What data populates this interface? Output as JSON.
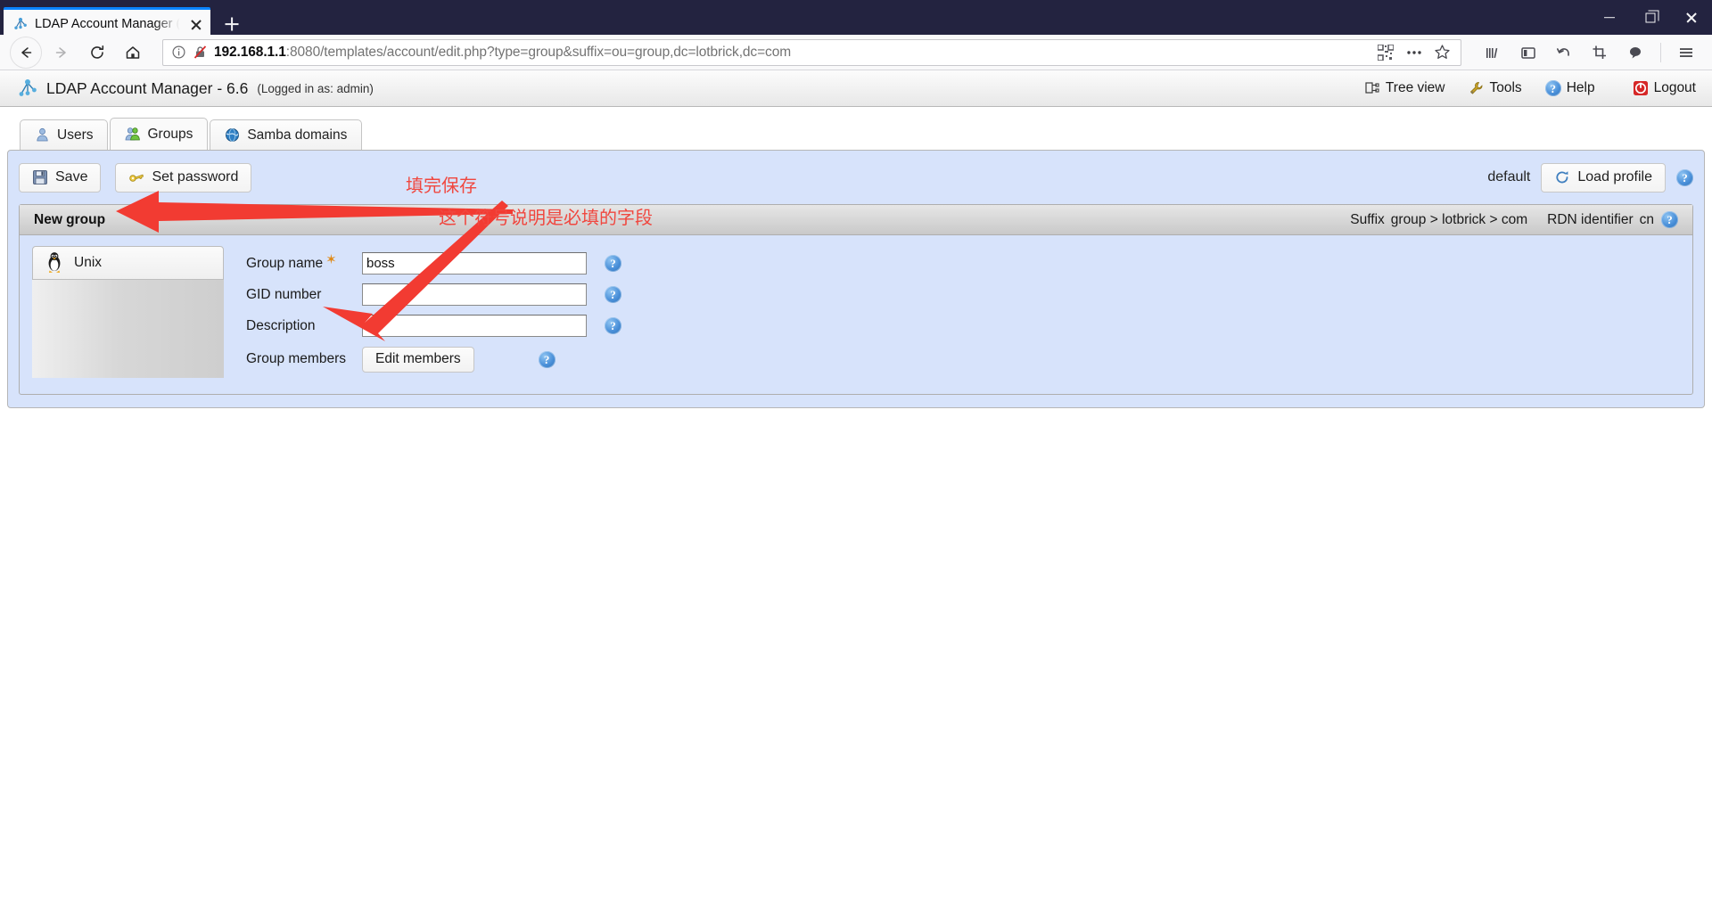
{
  "browser": {
    "tab": {
      "title": "LDAP Account Manager (ope",
      "favicon": "ldap-tree-icon",
      "close": "close-icon"
    },
    "new_tab_label": "+",
    "window_controls": {
      "minimize": "minimize-icon",
      "maximize": "restore-icon",
      "close": "close-icon"
    },
    "nav": {
      "back": "back-arrow-icon",
      "forward": "forward-arrow-icon",
      "reload": "reload-icon",
      "home": "home-icon"
    },
    "url": {
      "host": "192.168.1.1",
      "rest": ":8080/templates/account/edit.php?type=group&suffix=ou=group,dc=lotbrick,dc=com",
      "full": "192.168.1.1:8080/templates/account/edit.php?type=group&suffix=ou=group,dc=lotbrick,dc=com",
      "info_icon": "page-info-icon",
      "insecure_icon": "broken-lock-icon",
      "qr_icon": "qr-code-icon",
      "more_icon": "ellipsis-icon",
      "bookmark_icon": "star-icon"
    },
    "toolbar_right": [
      "library-icon",
      "sidebar-icon",
      "undo-icon",
      "screenshot-icon",
      "pocket-icon",
      "menu-icon"
    ]
  },
  "app": {
    "logo": "lam-tree-icon",
    "title": "LDAP Account Manager - 6.6",
    "logged_in": "(Logged in as: admin)",
    "nav": [
      {
        "label": "Tree view",
        "icon": "tree-view-icon"
      },
      {
        "label": "Tools",
        "icon": "wrench-icon"
      },
      {
        "label": "Help",
        "icon": "help-icon"
      },
      {
        "label": "Logout",
        "icon": "logout-icon"
      }
    ]
  },
  "tabs": [
    {
      "label": "Users",
      "icon": "user-icon",
      "active": false
    },
    {
      "label": "Groups",
      "icon": "group-icon",
      "active": true
    },
    {
      "label": "Samba domains",
      "icon": "globe-icon",
      "active": false
    }
  ],
  "toolbar": {
    "save_label": "Save",
    "save_icon": "floppy-disk-icon",
    "set_password_label": "Set password",
    "set_password_icon": "key-icon",
    "profile_name": "default",
    "load_profile_label": "Load profile",
    "load_profile_icon": "refresh-circle-icon",
    "help_icon": "help-icon"
  },
  "form": {
    "heading": "New group",
    "suffix_label": "Suffix",
    "suffix_value": "group > lotbrick > com",
    "rdn_label": "RDN identifier",
    "rdn_value": "cn",
    "help_icon": "help-icon",
    "module": {
      "label": "Unix",
      "icon": "penguin-icon"
    },
    "fields": [
      {
        "label": "Group name",
        "required": true,
        "type": "text",
        "value": "boss",
        "help": "help-icon"
      },
      {
        "label": "GID number",
        "required": false,
        "type": "text",
        "value": "",
        "help": "help-icon"
      },
      {
        "label": "Description",
        "required": false,
        "type": "text",
        "value": "",
        "help": "help-icon"
      },
      {
        "label": "Group members",
        "required": false,
        "type": "button",
        "value": "Edit members",
        "help": "help-icon"
      }
    ]
  },
  "annotations": {
    "color": "#f0473f",
    "note_save": "填完保存",
    "note_required": "这个符号说明是必填的字段",
    "arrow_to_save": "red-arrow-left",
    "arrow_to_asterisk": "red-arrow-diagonal"
  }
}
